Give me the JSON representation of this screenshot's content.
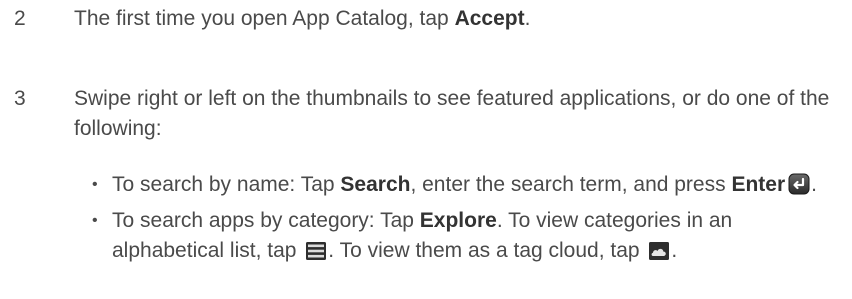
{
  "steps": [
    {
      "number": "2",
      "text_before": "The first time you open App Catalog, tap ",
      "bold": "Accept",
      "text_after": "."
    },
    {
      "number": "3",
      "text": "Swipe right or left on the thumbnails to see featured applications, or do one of the following:"
    }
  ],
  "bullets": [
    {
      "prefix": "To search by name: Tap ",
      "bold1": "Search",
      "middle": ", enter the search term, and press ",
      "bold2": "Enter",
      "icon": "enter-key-icon",
      "suffix": "."
    },
    {
      "prefix": "To search apps by category: Tap ",
      "bold1": "Explore",
      "middle": ". To view categories in an alphabetical list, tap ",
      "icon1": "list-view-icon",
      "middle2": ". To view them as a tag cloud, tap ",
      "icon2": "cloud-view-icon",
      "suffix": "."
    }
  ]
}
